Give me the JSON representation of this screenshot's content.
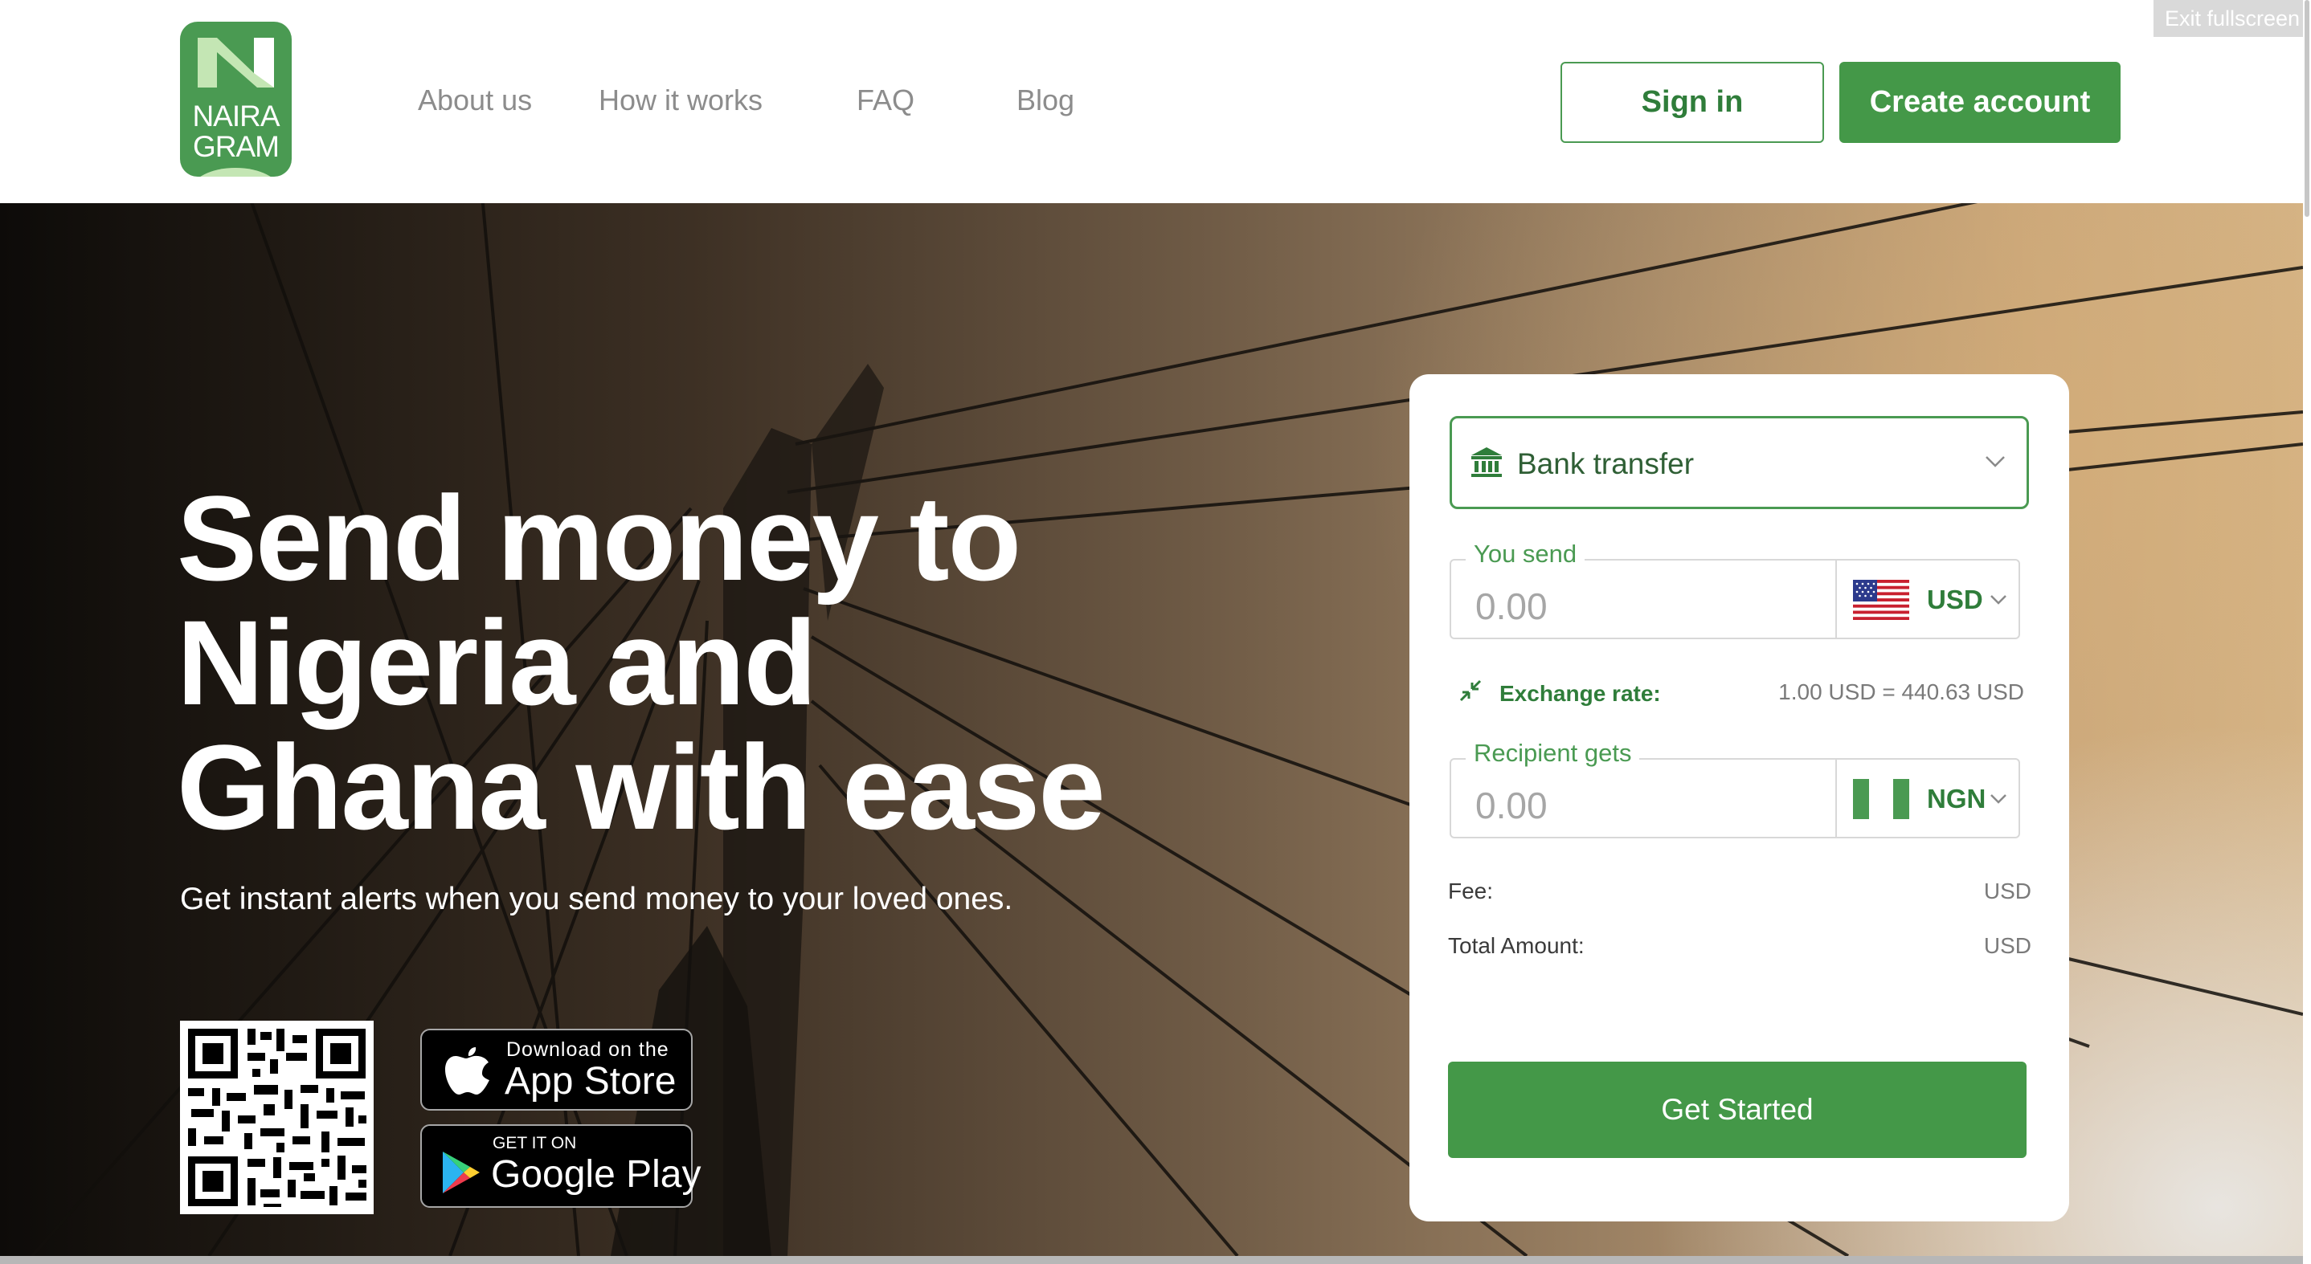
{
  "brand": {
    "logo_line1": "NAIRA",
    "logo_line2": "GRAM"
  },
  "nav": {
    "items": [
      "About us",
      "How it works",
      "FAQ",
      "Blog"
    ],
    "signin_label": "Sign in",
    "create_label": "Create account"
  },
  "overlay": {
    "exit_fullscreen": "Exit fullscreen"
  },
  "hero": {
    "title_lines": [
      "Send money to",
      "Nigeria and",
      "Ghana with ease"
    ],
    "subtitle": "Get instant alerts when you send money to your loved ones."
  },
  "stores": {
    "apple_small": "Download on the",
    "apple_big": "App Store",
    "google_small": "GET IT ON",
    "google_big": "Google Play"
  },
  "calculator": {
    "method": "Bank transfer",
    "send": {
      "label": "You send",
      "placeholder": "0.00",
      "currency": "USD"
    },
    "rate": {
      "label": "Exchange rate:",
      "value": "1.00  USD = 440.63  USD"
    },
    "receive": {
      "label": "Recipient gets",
      "placeholder": "0.00",
      "currency": "NGN"
    },
    "fee": {
      "label": "Fee:",
      "value": "USD"
    },
    "total": {
      "label": "Total Amount:",
      "value": "USD"
    },
    "cta": "Get Started"
  },
  "colors": {
    "brand_green": "#449848",
    "text_green": "#2f7d3a",
    "nav_gray": "#8c8c8c"
  },
  "icons": [
    "bank-icon",
    "chevron-down-icon",
    "us-flag-icon",
    "ng-flag-icon",
    "exchange-icon",
    "apple-icon",
    "google-play-icon",
    "qr-code"
  ]
}
